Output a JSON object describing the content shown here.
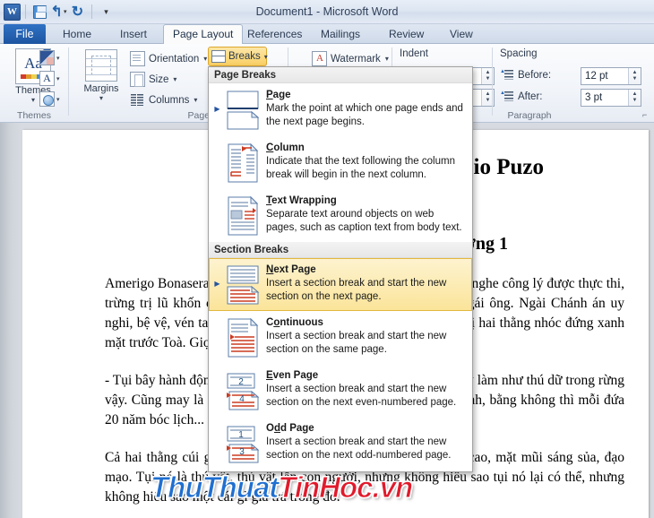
{
  "window": {
    "title": "Document1  -  Microsoft Word",
    "app_icon": "word-icon"
  },
  "quick_access": {
    "items": [
      {
        "name": "save-icon",
        "label": "Save"
      },
      {
        "name": "undo-icon",
        "label": "Undo",
        "glyph": "↰"
      },
      {
        "name": "redo-icon",
        "label": "Redo",
        "glyph": "↻"
      },
      {
        "name": "customize-qat-icon",
        "label": "Customize Quick Access Toolbar",
        "glyph": "▾"
      }
    ]
  },
  "tabs": [
    {
      "label": "File",
      "active": false,
      "is_file": true
    },
    {
      "label": "Home",
      "active": false
    },
    {
      "label": "Insert",
      "active": false
    },
    {
      "label": "Page Layout",
      "active": true
    },
    {
      "label": "References",
      "active": false
    },
    {
      "label": "Mailings",
      "active": false
    },
    {
      "label": "Review",
      "active": false
    },
    {
      "label": "View",
      "active": false
    }
  ],
  "ribbon": {
    "themes_group": {
      "label": "Themes",
      "main_button": "Themes",
      "mini_buttons": [
        "theme-colors",
        "theme-fonts",
        "theme-effects"
      ]
    },
    "page_setup_group": {
      "label": "Page Setup",
      "margins": "Margins",
      "orientation": "Orientation",
      "size": "Size",
      "columns": "Columns",
      "breaks": "Breaks"
    },
    "arrange_group": {
      "watermark": "Watermark"
    },
    "indent_group": {
      "label": "Indent"
    },
    "spacing_group": {
      "label": "Spacing",
      "paragraph_label": "Paragraph",
      "before_label": "Before:",
      "before_value": "12 pt",
      "after_label": "After:",
      "after_value": "3 pt"
    }
  },
  "breaks_menu": {
    "sections": [
      {
        "heading": "Page Breaks",
        "items": [
          {
            "title": "Page",
            "accel": "P",
            "desc": "Mark the point at which one page ends and the next page begins.",
            "icon": "page-break-icon",
            "selected": false,
            "marker": true
          },
          {
            "title": "Column",
            "accel": "C",
            "desc": "Indicate that the text following the column break will begin in the next column.",
            "icon": "column-break-icon",
            "selected": false,
            "marker": false
          },
          {
            "title": "Text Wrapping",
            "accel": "T",
            "desc": "Separate text around objects on web pages, such as caption text from body text.",
            "icon": "text-wrapping-break-icon",
            "selected": false,
            "marker": false
          }
        ]
      },
      {
        "heading": "Section Breaks",
        "items": [
          {
            "title": "Next Page",
            "accel": "N",
            "desc": "Insert a section break and start the new section on the next page.",
            "icon": "next-page-break-icon",
            "selected": true,
            "marker": true
          },
          {
            "title": "Continuous",
            "accel": "o",
            "desc": "Insert a section break and start the new section on the same page.",
            "icon": "continuous-break-icon",
            "selected": false,
            "marker": false
          },
          {
            "title": "Even Page",
            "accel": "E",
            "desc": "Insert a section break and start the new section on the next even-numbered page.",
            "icon": "even-page-break-icon",
            "selected": false,
            "marker": false
          },
          {
            "title": "Odd Page",
            "accel": "d",
            "desc": "Insert a section break and start the new section on the next odd-numbered page.",
            "icon": "odd-page-break-icon",
            "selected": false,
            "marker": false
          }
        ]
      }
    ]
  },
  "document": {
    "title": "Mario Puzo",
    "heading": "Chương 1",
    "paragraphs": [
      "Amerigo Bonasera ngồi tại Toà án Hình sự Nữu Ước, Phòng 3 để nghe công lý được thực thi, trừng trị lũ khốn can tội bạo hành thương tích trên người con gái ông. Ngài Chánh án uy nghi, bệ vệ, vén tay áo thụng đen như để đích thân ra tay trừng trị hai thằng nhóc đứng xanh mặt trước Toà. Giọng ngài sang sảng đầy uy lực.",
      "- Tụi bây hành động như những thằng mất dạy tệ hại nhất. Tụi bây làm như thú dữ trong rừng vậy. Cũng may là cô bé đáng thương không bị xâm phạm tiết hạnh, bằng không thì mỗi đứa 20 năm bóc lịch...",
      "Cả hai thằng cúi gằm mặt, quần áo bảnh bao, đầu tóc chải hớt cao, mặt mũi sáng sủa, đạo mạo. Tụi nó là thú vật, thú vật lẫn con người, nhưng không hiểu sao tụi nó lại có thể, nhưng không hiểu sao một cái gì giả trá trong đó."
    ],
    "watermark": {
      "part1": "ThuThuat",
      "part2": "TinHoc.vn",
      "color1": "#1f6fd0",
      "color2": "#e01b2c"
    }
  }
}
